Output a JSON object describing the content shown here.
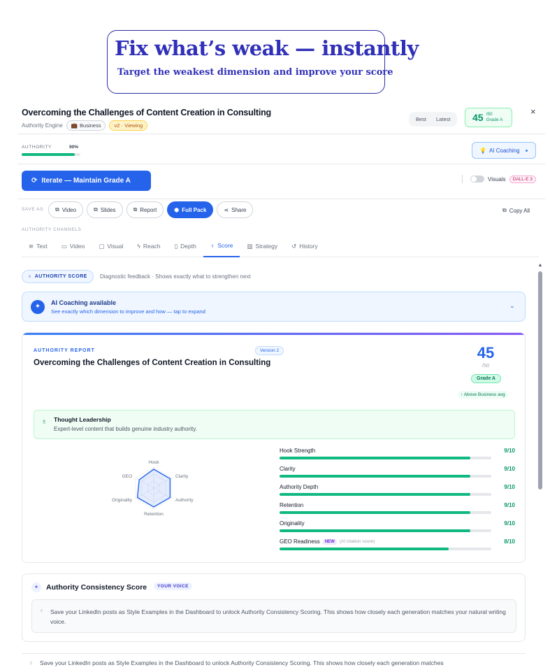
{
  "callout": {
    "title": "Fix what’s weak — instantly",
    "subtitle": "Target the weakest dimension and improve your score"
  },
  "header": {
    "title": "Overcoming the Challenges of Content Creation in Consulting",
    "engine": "Authority Engine",
    "category": "Business",
    "version": "v2 · Viewing",
    "seg_best": "Best",
    "seg_latest": "Latest",
    "score": "45",
    "score_out_of": "/50",
    "grade": "Grade A",
    "close": "×"
  },
  "authority": {
    "label": "AUTHORITY",
    "percent_label": "90%",
    "percent": 0.9,
    "coaching_button": "AI Coaching"
  },
  "actions": {
    "iterate": "Iterate — Maintain Grade A",
    "visuals": "Visuals",
    "dalle": "DALL-E 3",
    "save_as": "SAVE AS",
    "buttons": [
      "Video",
      "Slides",
      "Report",
      "Full Pack",
      "Share"
    ],
    "copy_all": "Copy All"
  },
  "channels": {
    "label": "AUTHORITY CHANNELS",
    "tabs": [
      "Text",
      "Video",
      "Visual",
      "Reach",
      "Depth",
      "Score",
      "Strategy",
      "History"
    ],
    "active": "Score"
  },
  "section": {
    "badge": "AUTHORITY SCORE",
    "desc": "Diagnostic feedback · Shows exactly what to strengthen next"
  },
  "coach_bar": {
    "title": "AI Coaching available",
    "subtitle": "See exactly which dimension to improve and how — tap to expand"
  },
  "report": {
    "label": "AUTHORITY REPORT",
    "version": "Version 2",
    "title": "Overcoming the Challenges of Content Creation in Consulting",
    "score": "45",
    "out_of": "/50",
    "grade": "Grade A",
    "above": "↑ Above Business avg",
    "leadership_title": "Thought Leadership",
    "leadership_desc": "Expert-level content that builds genuine industry authority.",
    "radar_labels": [
      "Hook",
      "Clarity",
      "Authority",
      "Retention",
      "Originality",
      "GEO"
    ],
    "radar_values": [
      9,
      9,
      9,
      9,
      9,
      8
    ],
    "dimensions": [
      {
        "name": "Hook Strength",
        "score": "9/10",
        "value": 0.9
      },
      {
        "name": "Clarity",
        "score": "9/10",
        "value": 0.9
      },
      {
        "name": "Authority Depth",
        "score": "9/10",
        "value": 0.9
      },
      {
        "name": "Retention",
        "score": "9/10",
        "value": 0.9
      },
      {
        "name": "Originality",
        "score": "9/10",
        "value": 0.9
      },
      {
        "name": "GEO Readiness",
        "score": "8/10",
        "value": 0.8,
        "tag": "NEW",
        "note": "(AI citation score)"
      }
    ]
  },
  "consistency": {
    "title": "Authority Consistency Score",
    "tag": "YOUR VOICE",
    "text": "Save your LinkedIn posts as Style Examples in the Dashboard to unlock Authority Consistency Scoring. This shows how closely each generation matches your natural writing voice.",
    "ghost_text": "Save your LinkedIn posts as Style Examples in the Dashboard to unlock Authority Consistency Scoring. This shows how closely each generation matches"
  }
}
